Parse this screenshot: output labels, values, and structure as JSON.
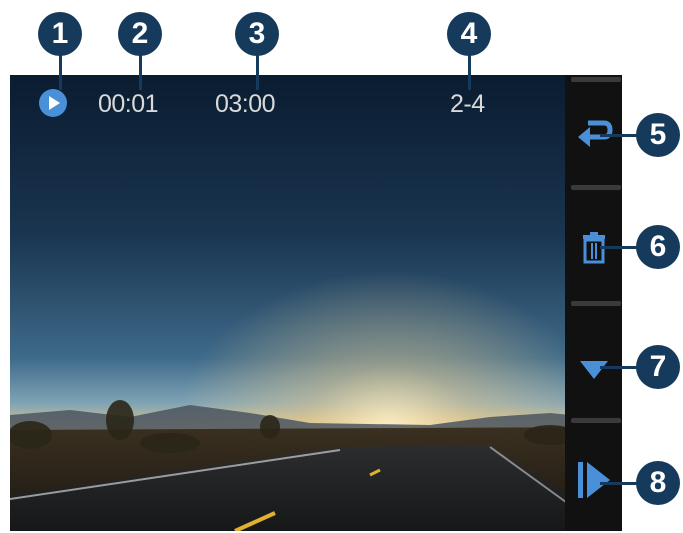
{
  "playback": {
    "elapsed": "00:01",
    "total": "03:00",
    "index": "2-4"
  },
  "callouts": [
    "1",
    "2",
    "3",
    "4",
    "5",
    "6",
    "7",
    "8"
  ],
  "icons": {
    "status": "play-circle-icon",
    "back": "return-arrow-icon",
    "delete": "trash-icon",
    "down": "triangle-down-icon",
    "play": "play-icon"
  },
  "colors": {
    "callout": "#163a5c",
    "status_icon": "#4a90d9",
    "sidebar_icon": "#4a90d9",
    "text": "#d9d9d9"
  }
}
